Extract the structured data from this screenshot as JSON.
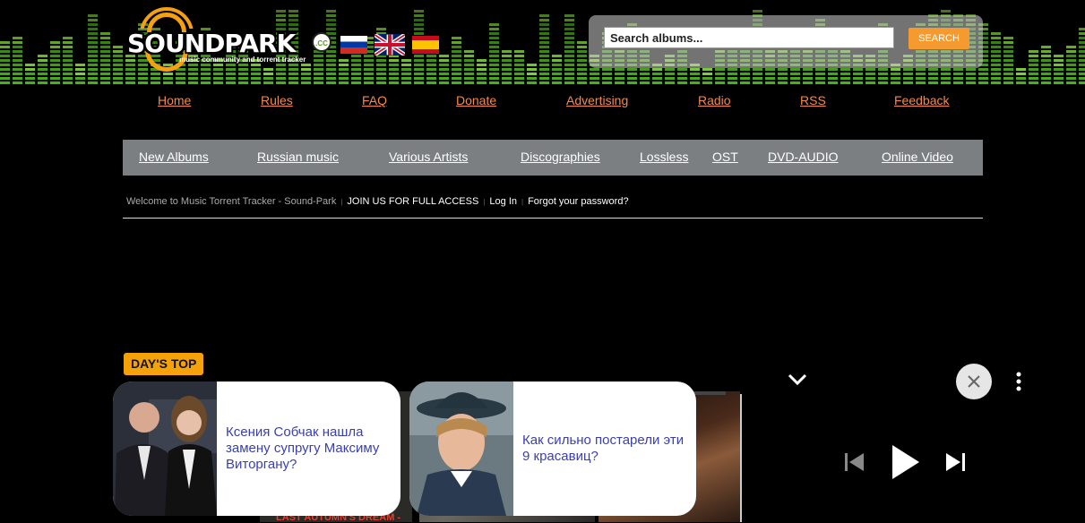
{
  "logo": {
    "text": "SOUNDPARK",
    "domain_badge": ".CC",
    "tagline": "music community and torrent tracker"
  },
  "flags": [
    "Russian",
    "English",
    "Spanish"
  ],
  "search": {
    "placeholder": "Search albums...",
    "button_label": "SEARCH"
  },
  "top_nav": [
    "Home",
    "Rules",
    "FAQ",
    "Donate",
    "Advertising",
    "Radio",
    "RSS",
    "Feedback"
  ],
  "menu": [
    "New Albums",
    "Russian music",
    "Various Artists",
    "Discographies",
    "Lossless",
    "OST",
    "DVD-AUDIO",
    "Online Video"
  ],
  "welcome": {
    "text": "Welcome to Music Torrent Tracker - Sound-Park",
    "join": "JOIN US FOR FULL ACCESS",
    "login": "Log In",
    "forgot": "Forgot your password?"
  },
  "days_top": "DAY'S TOP",
  "strip_caption": "LAST AUTUMN'S DREAM -",
  "ads": [
    {
      "text": "Ксения Собчак нашла замену супругу Максиму Виторгану?"
    },
    {
      "text": "Как сильно постарели эти 9 красавиц?"
    }
  ],
  "icons": {
    "collapse": "chevron-down-icon",
    "close": "close-icon",
    "menu": "more-vertical-icon",
    "prev": "skip-previous-icon",
    "play": "play-icon",
    "next": "skip-next-icon"
  },
  "colors": {
    "accent": "#f5a20a",
    "nav_link": "#f28a4a",
    "menu_bg": "#7b7f82",
    "eq_green": "#4cb21a",
    "ad_text": "#3a3fb0"
  }
}
